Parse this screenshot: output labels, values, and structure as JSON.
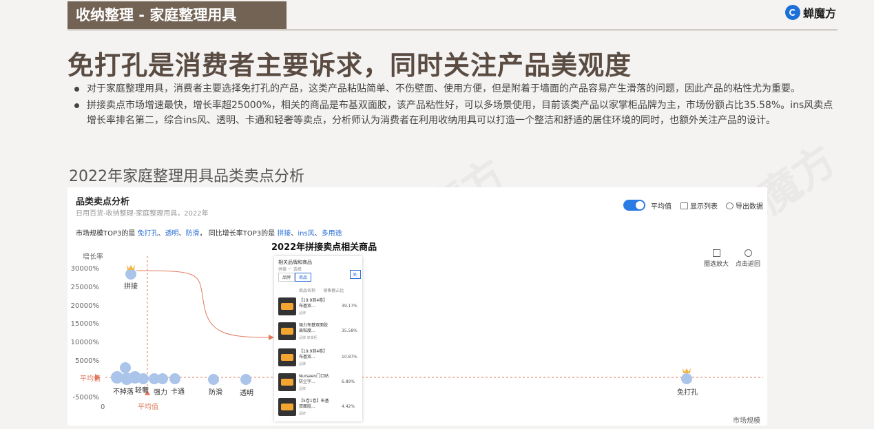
{
  "header": {
    "tag": "收纳整理 - 家庭整理用具",
    "logo_text": "蝉魔方",
    "logo_icon": "chanmofang-logo-icon"
  },
  "headline": "免打孔是消费者主要诉求，同时关注产品美观度",
  "bullets": [
    "对于家庭整理用具，消费者主要选择免打孔的产品，这类产品粘贴简单、不伤壁面、使用方便，但是附着于墙面的产品容易产生滑落的问题，因此产品的粘性尤为重要。",
    "拼接卖点市场增速最快，增长率超25000%，相关的商品是布基双面胶，该产品粘性好，可以多场景使用，目前该类产品以家掌柜品牌为主，市场份额占比35.58%。ins风卖点增长率排名第二，综合ins风、透明、卡通和轻奢等卖点，分析师认为消费者在利用收纳用具可以打造一个整洁和舒适的居住环境的同时，也额外关注产品的设计。"
  ],
  "subtitle": "2022年家庭整理用具品类卖点分析",
  "panel": {
    "title": "品类卖点分析",
    "breadcrumb": "日用百货-收纳整理-家庭整理用具，2022年",
    "top3_prefix": "市场规模TOP3的是",
    "top3_scale": [
      "免打孔",
      "透明",
      "防滑"
    ],
    "top3_growth_prefix": "同比增长率TOP3的是",
    "top3_growth": [
      "拼接",
      "ins风",
      "多用途"
    ],
    "toggle_label": "平均值",
    "toggle_on": true,
    "show_list": "显示列表",
    "export": "导出数据",
    "tool_zoom": "圈选放大",
    "tool_reset": "点击返回",
    "avg_label": "平均值"
  },
  "chart_data": {
    "type": "scatter",
    "ylabel": "增长率",
    "xlabel": "市场规模",
    "yticks": [
      "30000%",
      "25000%",
      "20000%",
      "15000%",
      "10000%",
      "5000%",
      "0",
      "-5000%"
    ],
    "ylim": [
      -5000,
      30000
    ],
    "x_origin_label": "0",
    "points": [
      {
        "label": "拼接",
        "y": 28500,
        "highlight": true
      },
      {
        "label": "不掉落"
      },
      {
        "label": "轻奢"
      },
      {
        "label": "强力"
      },
      {
        "label": "卡通"
      },
      {
        "label": "防滑"
      },
      {
        "label": "透明"
      },
      {
        "label": "免打孔",
        "highlight": true
      }
    ]
  },
  "popup": {
    "heading": "2022年拼接卖点相关商品",
    "subheading": "相关品牌和商品",
    "meta": "拼接 一 选择",
    "tabs": [
      "品牌",
      "商品"
    ],
    "button": "关·",
    "col_name": "商品名称",
    "col_share": "销售额占比",
    "products": [
      {
        "name": "【19.9到4卷】布基双...",
        "shop": "品牌",
        "share": "39.17%"
      },
      {
        "name": "强力布基双面胶高粘度...",
        "shop": "品牌 家掌柜",
        "share": "35.58%"
      },
      {
        "name": "【19.9到4卷】布基双...",
        "shop": "品牌",
        "share": "10.87%"
      },
      {
        "name": "Nurseen门口贴防尘字...",
        "shop": "品牌",
        "share": "6.89%"
      },
      {
        "name": "【5卷1卷】布基双面胶...",
        "shop": "品牌",
        "share": "4.42%"
      }
    ]
  },
  "watermark": "蝉魔方"
}
